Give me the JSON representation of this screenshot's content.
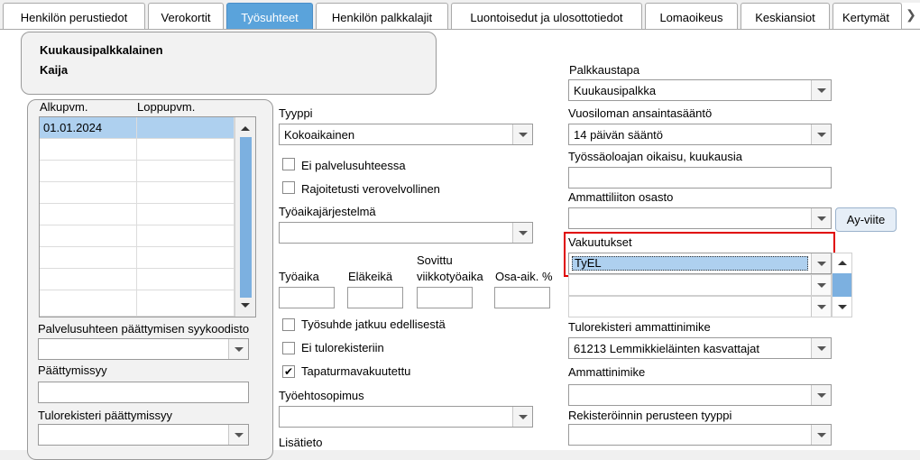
{
  "tabs": [
    {
      "label": "Henkilön perustiedot",
      "active": false
    },
    {
      "label": "Verokortit",
      "active": false
    },
    {
      "label": "Työsuhteet",
      "active": true
    },
    {
      "label": "Henkilön palkkalajit",
      "active": false
    },
    {
      "label": "Luontoisedut ja ulosottotiedot",
      "active": false
    },
    {
      "label": "Lomaoikeus",
      "active": false
    },
    {
      "label": "Keskiansiot",
      "active": false
    },
    {
      "label": "Kertymät",
      "active": false
    }
  ],
  "employee": {
    "line1": "Kuukausipalkkalainen",
    "line2": "Kaija"
  },
  "periods": {
    "col_start": "Alkupvm.",
    "col_end": "Loppupvm.",
    "rows": [
      {
        "start": "01.01.2024",
        "end": ""
      }
    ]
  },
  "left": {
    "end_reason_label": "Palvelusuhteen päättymisen syykoodisto",
    "end_reason_value": "",
    "end_date_label": "Päättymissyy",
    "end_date_value": "",
    "income_reg_end_label": "Tulorekisteri päättymissyy",
    "income_reg_end_value": ""
  },
  "middle": {
    "type_label": "Tyyppi",
    "type_value": "Kokoaikainen",
    "not_employment_label": "Ei palvelusuhteessa",
    "limited_tax_label": "Rajoitetusti verovelvollinen",
    "worktime_system_label": "Työaikajärjestelmä",
    "worktime_system_value": "",
    "worktime_label": "Työaika",
    "retirement_age_label": "Eläkeikä",
    "agreed_weekly_label_1": "Sovittu",
    "agreed_weekly_label_2": "viikkotyöaika",
    "part_time_label": "Osa-aik. %",
    "continues_label": "Työsuhde jatkuu edellisestä",
    "no_income_reg_label": "Ei tulorekisteriin",
    "accident_ins_label": "Tapaturmavakuutettu",
    "accident_ins_checked": true,
    "collective_agreement_label": "Työehtosopimus",
    "collective_agreement_value": "",
    "extra_info_label": "Lisätieto"
  },
  "right": {
    "pay_method_label": "Palkkaustapa",
    "pay_method_value": "Kuukausipalkka",
    "vacation_rule_label": "Vuosiloman ansaintasääntö",
    "vacation_rule_value": "14 päivän sääntö",
    "employment_months_label": "Työssäoloajan oikaisu, kuukausia",
    "employment_months_value": "",
    "union_label": "Ammattiliiton osasto",
    "union_value": "",
    "ay_button": "Ay-viite",
    "insurances_label": "Vakuutukset",
    "insurance_value": "TyEL",
    "occupation_reg_label": "Tulorekisteri ammattinimike",
    "occupation_reg_value": "61213 Lemmikkieläinten kasvattajat",
    "occupation_label": "Ammattinimike",
    "occupation_value": "",
    "registration_basis_label": "Rekisteröinnin perusteen tyyppi",
    "registration_basis_value": ""
  },
  "colors": {
    "accent": "#5aa3db",
    "selection": "#aed0ef",
    "highlight": "#e00000"
  }
}
